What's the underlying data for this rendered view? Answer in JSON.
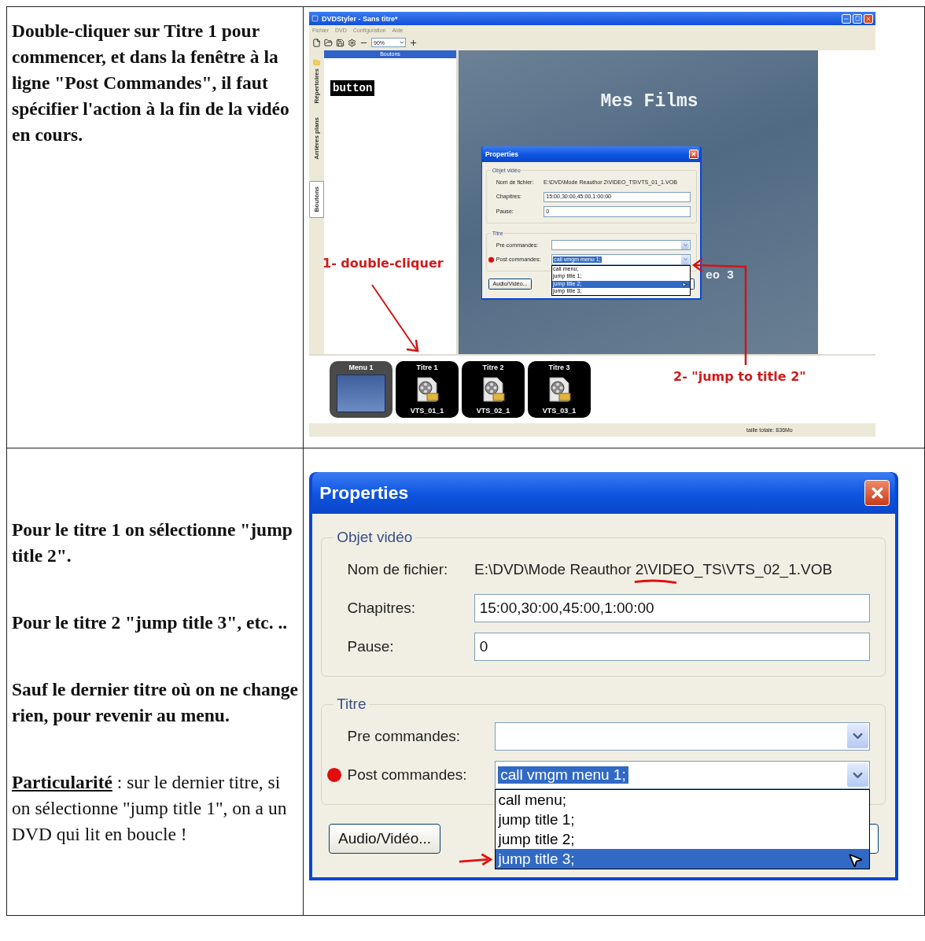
{
  "rows": [
    {
      "instructions": [
        {
          "kind": "bold",
          "text": "Double-cliquer sur Titre 1 pour commencer, et dans la fenêtre à la ligne \"Post Commandes\", il faut spécifier l'action à la fin de la vidéo en cours."
        }
      ],
      "screenshot": {
        "kind": "editor",
        "window_title": "DVDStyler - Sans titre*",
        "menu": [
          "Fichier",
          "DVD",
          "Configuration",
          "Aide"
        ],
        "zoom": "90%",
        "side_tabs": [
          {
            "label": "Répertoires",
            "selected": false
          },
          {
            "label": "Arrières plans",
            "selected": false
          },
          {
            "label": "Boutons",
            "selected": true
          }
        ],
        "panel_title": "Boutons",
        "panel_item": "button",
        "canvas_title": "Mes Films",
        "canvas_text": "eo 3",
        "dialog": {
          "title": "Properties",
          "video_group": "Objet vidéo",
          "file_label": "Nom de fichier:",
          "file": "E:\\DVD\\Mode Reauthor 2\\VIDEO_TS\\VTS_01_1.VOB",
          "chapters_label": "Chapitres:",
          "chapters": "15:00,30:00,45:00,1:00:00",
          "pause_label": "Pause:",
          "pause": "0",
          "title_group": "Titre",
          "pre_label": "Pre commandes:",
          "post_label": "Post commandes:",
          "post": "call vmgm menu 1;",
          "options": [
            {
              "label": "call menu;",
              "selected": false
            },
            {
              "label": "jump title 1;",
              "selected": false
            },
            {
              "label": "jump title 2;",
              "selected": true
            },
            {
              "label": "jump title 3;",
              "selected": false
            }
          ],
          "audio_button": "Audio/Vidéo..."
        },
        "thumbnails": [
          {
            "kind": "menu",
            "title": "Menu 1",
            "selected": true
          },
          {
            "kind": "title",
            "title": "Titre 1",
            "file": "VTS_01_1",
            "selected": false
          },
          {
            "kind": "title",
            "title": "Titre 2",
            "file": "VTS_02_1",
            "selected": false
          },
          {
            "kind": "title",
            "title": "Titre 3",
            "file": "VTS_03_1",
            "selected": false
          }
        ],
        "status": "taille totale: 836Mo",
        "annotations": [
          "1- double-cliquer",
          "2- \"jump to title 2\""
        ]
      }
    },
    {
      "instructions": [
        {
          "kind": "bold",
          "text": "Pour le titre 1 on sélectionne \"jump title 2\"."
        },
        {
          "kind": "bold",
          "text": "Pour le titre 2 \"jump title 3\", etc. .."
        },
        {
          "kind": "bold",
          "text": "Sauf le dernier titre où on ne change rien, pour revenir au menu."
        },
        {
          "kind": "note",
          "text": "**Particularité** : sur le dernier titre, si on sélectionne \"jump title 1\", on a un DVD qui lit en boucle !"
        }
      ],
      "screenshot": {
        "kind": "dialog",
        "dialog": {
          "title": "Properties",
          "video_group": "Objet vidéo",
          "file_label": "Nom de fichier:",
          "file": "E:\\DVD\\Mode Reauthor 2\\VIDEO_TS\\VTS_02_1.VOB",
          "chapters_label": "Chapitres:",
          "chapters": "15:00,30:00,45:00,1:00:00",
          "pause_label": "Pause:",
          "pause": "0",
          "title_group": "Titre",
          "pre_label": "Pre commandes:",
          "post_label": "Post commandes:",
          "post": "call vmgm menu 1;",
          "options": [
            {
              "label": "call menu;",
              "selected": false
            },
            {
              "label": "jump title 1;",
              "selected": false
            },
            {
              "label": "jump title 2;",
              "selected": false
            },
            {
              "label": "jump title 3;",
              "selected": true
            }
          ],
          "audio_button": "Audio/Vidéo..."
        }
      }
    }
  ]
}
